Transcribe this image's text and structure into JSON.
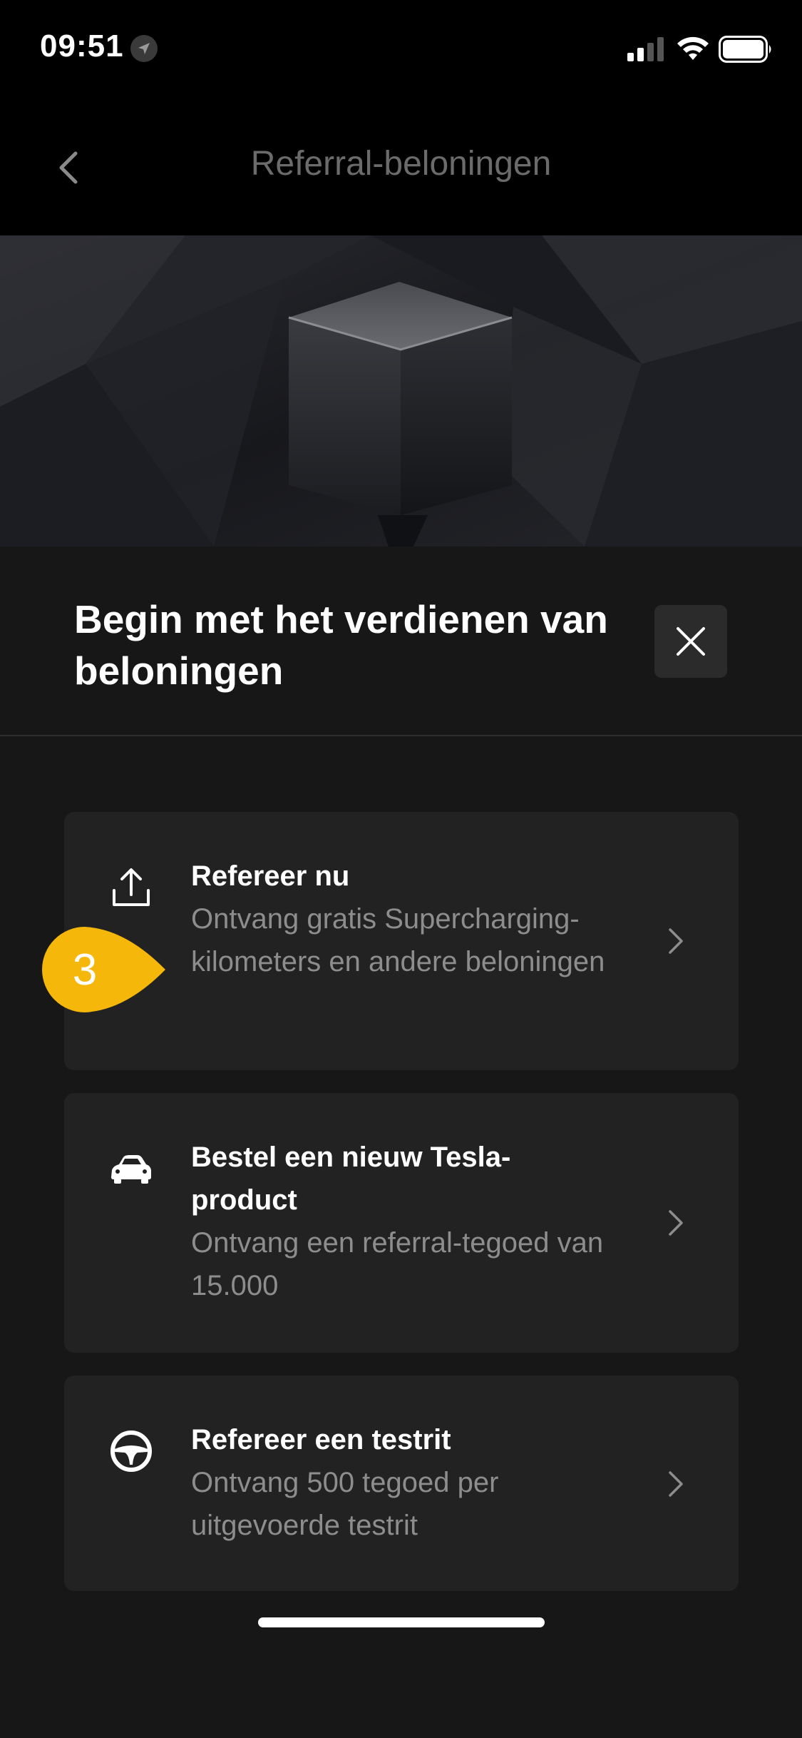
{
  "status_bar": {
    "time": "09:51",
    "location_icon": "location-arrow-icon",
    "signal_icon": "cellular-signal-icon",
    "wifi_icon": "wifi-icon",
    "battery_icon": "battery-icon"
  },
  "header": {
    "back_icon": "chevron-left-icon",
    "title": "Referral-beloningen"
  },
  "hero": {
    "image": "cube-hero-image"
  },
  "sheet": {
    "title": "Begin met het verdienen van beloningen",
    "close_icon": "close-icon"
  },
  "cards": [
    {
      "icon": "share-upload-icon",
      "title": "Refereer nu",
      "description": "Ontvang gratis Supercharging-kilometers en andere beloningen"
    },
    {
      "icon": "car-icon",
      "title": "Bestel een nieuw Tesla-product",
      "description": "Ontvang een referral-tegoed van 15.000"
    },
    {
      "icon": "steering-wheel-icon",
      "title": "Refereer een testrit",
      "description": "Ontvang 500 tegoed per uitgevoerde testrit"
    }
  ],
  "annotation": {
    "step_number": "3",
    "color": "#F5B70A"
  },
  "colors": {
    "background": "#000000",
    "sheet": "#171717",
    "card": "#222222",
    "muted_text": "#8d8d8d"
  }
}
